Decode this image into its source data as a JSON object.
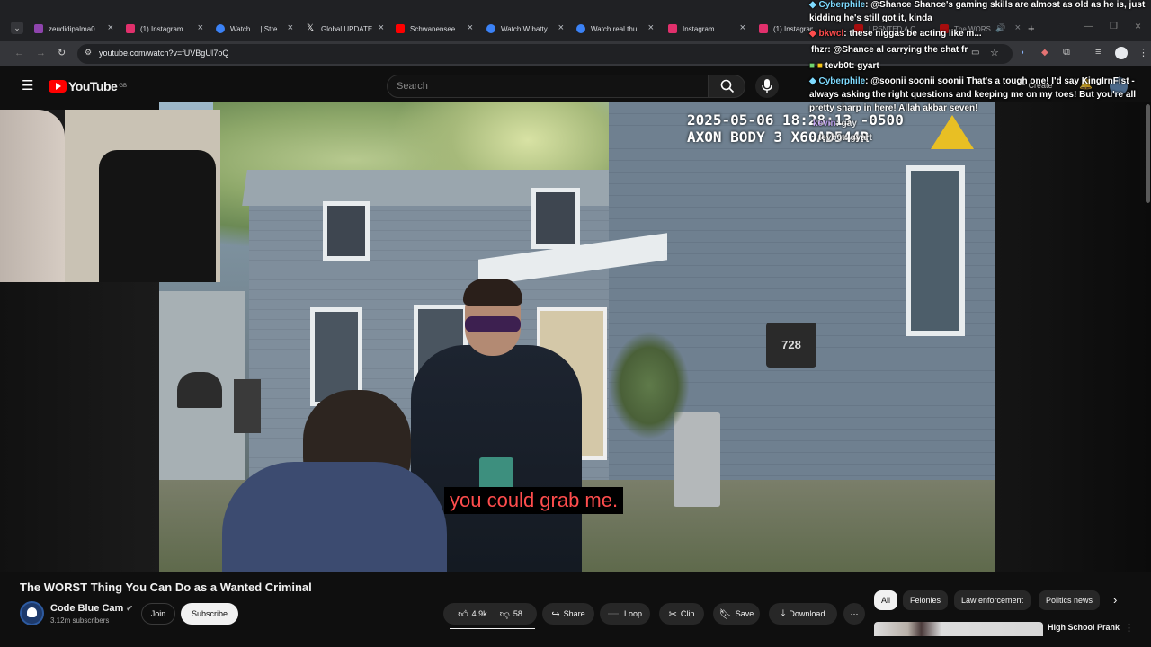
{
  "browser": {
    "tabs": [
      {
        "label": "zeudidipalma0",
        "color": "#8e44ad"
      },
      {
        "label": "(1) Instagram",
        "color": "#e1306c"
      },
      {
        "label": "Watch ... | Stre",
        "color": "#3b82f6"
      },
      {
        "label": "Global UPDATE",
        "color": "#ffffff"
      },
      {
        "label": "Schwanensee.",
        "color": "#ff0000"
      },
      {
        "label": "Watch W batty",
        "color": "#3b82f6"
      },
      {
        "label": "Watch real thu",
        "color": "#3b82f6"
      },
      {
        "label": "Instagram",
        "color": "#e1306c"
      },
      {
        "label": "(1) Instagram",
        "color": "#e1306c"
      }
    ],
    "url": "youtube.com/watch?v=fUVBgUI7oQ",
    "overlay_tab_label": "I RENTED A C",
    "overlay_tab_label2": "The WORS"
  },
  "youtube": {
    "logo_text": "YouTube",
    "region": "GB",
    "search_placeholder": "Search",
    "create_label": "Create"
  },
  "video": {
    "timestamp_line1": "2025-05-06 18:28:13 -0500",
    "timestamp_line2": "AXON BODY 3 X60AD544R",
    "caption": "you could grab me.",
    "house_number": "728",
    "title": "The WORST Thing You Can Do as a Wanted Criminal"
  },
  "channel": {
    "name": "Code Blue Cam",
    "subscribers": "3.12m subscribers",
    "join_label": "Join",
    "subscribe_label": "Subscribe"
  },
  "actions": {
    "likes": "4.9k",
    "dislikes": "58",
    "share": "Share",
    "loop": "Loop",
    "clip": "Clip",
    "save": "Save",
    "download": "Download"
  },
  "chips": [
    "All",
    "Felonies",
    "Law enforcement",
    "Politics news"
  ],
  "recommended": {
    "title": "High School Prank"
  },
  "chat": [
    {
      "user": "Cyberphile",
      "color": "#7fdbff",
      "text": ": @Shance Shance's gaming skills are almost as old as he is, just"
    },
    {
      "user": "",
      "color": "#ffffff",
      "text": "kidding he's still got it, kinda"
    },
    {
      "user": "bkwcl",
      "color": "#ff4d4d",
      "text": ": these niggas be acting like m..."
    },
    {
      "user": "fhzr",
      "color": "#ffffff",
      "text": ": @Shance al carrying the chat fr"
    },
    {
      "user": "tevb0t",
      "color": "#ffffff",
      "text": ": gyart"
    },
    {
      "user": "Cyberphile",
      "color": "#7fdbff",
      "text": ": @soonii soonii soonii    That's a tough one! I'd say KingIrnFist -"
    },
    {
      "user": "",
      "color": "#ffffff",
      "text": "always asking the right questions and keeping me on my toes!    But you're all"
    },
    {
      "user": "",
      "color": "#ffffff",
      "text": "pretty sharp in here! Allah akbar seven!"
    },
    {
      "user": "kevin",
      "color": "#ffffff",
      "text": ": gay"
    },
    {
      "user": "tevb0t",
      "color": "#ffffff",
      "text": ": gyart"
    }
  ]
}
